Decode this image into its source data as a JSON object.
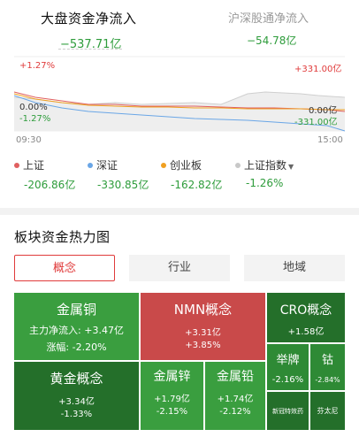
{
  "tabs": {
    "main_title": "大盘资金净流入",
    "main_value": "−537.71亿",
    "hs_title": "沪深股通净流入",
    "hs_value": "−54.78亿"
  },
  "chart": {
    "left_top": "+1.27%",
    "left_mid": "0.00%",
    "left_bottom": "-1.27%",
    "right_top": "+331.00亿",
    "right_mid": "0.00亿",
    "right_bottom": "-331.00亿",
    "time_start": "09:30",
    "time_end": "15:00"
  },
  "legend": [
    {
      "label": "上证",
      "value": "-206.86亿",
      "color": "#e06060"
    },
    {
      "label": "深证",
      "value": "-330.85亿",
      "color": "#6aa6e6"
    },
    {
      "label": "创业板",
      "value": "-162.82亿",
      "color": "#f0a020"
    },
    {
      "label": "上证指数",
      "value": "-1.26%",
      "color": "#c8c8c8"
    }
  ],
  "section": {
    "title": "板块资金热力图",
    "tabs": [
      "概念",
      "行业",
      "地域"
    ]
  },
  "heatmap": [
    {
      "name": "金属铜",
      "line1": "主力净流入: +3.47亿",
      "line2": "涨幅: -2.20%"
    },
    {
      "name": "NMN概念",
      "line1": "+3.31亿",
      "line2": "+3.85%"
    },
    {
      "name": "CRO概念",
      "line1": "+1.58亿",
      "line2": ""
    },
    {
      "name": "黄金概念",
      "line1": "+3.34亿",
      "line2": "-1.33%"
    },
    {
      "name": "金属锌",
      "line1": "+1.79亿",
      "line2": "-2.15%"
    },
    {
      "name": "金属铅",
      "line1": "+1.74亿",
      "line2": "-2.12%"
    },
    {
      "name": "举牌",
      "line1": "-2.16%",
      "line2": ""
    },
    {
      "name": "钴",
      "line1": "-2.84%",
      "line2": ""
    },
    {
      "name": "新冠特效药",
      "line1": "",
      "line2": ""
    },
    {
      "name": "芬太尼",
      "line1": "",
      "line2": ""
    }
  ]
}
